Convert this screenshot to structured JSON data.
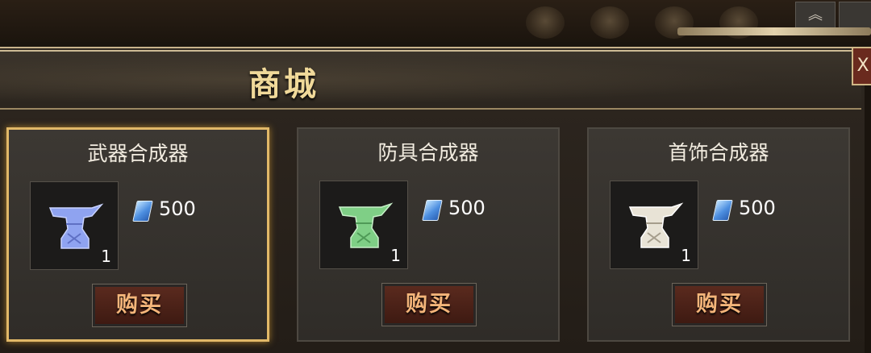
{
  "shop": {
    "title": "商城",
    "close_glyph": "X"
  },
  "items": [
    {
      "name": "武器合成器",
      "icon": "anvil-blue-icon",
      "color": "#8fa3f0",
      "quantity": "1",
      "price": "500",
      "currency_icon": "blue-gem-icon",
      "buy_label": "购买",
      "selected": true
    },
    {
      "name": "防具合成器",
      "icon": "anvil-green-icon",
      "color": "#7fcf86",
      "quantity": "1",
      "price": "500",
      "currency_icon": "blue-gem-icon",
      "buy_label": "购买",
      "selected": false
    },
    {
      "name": "首饰合成器",
      "icon": "anvil-white-icon",
      "color": "#e8e3d6",
      "quantity": "1",
      "price": "500",
      "currency_icon": "blue-gem-icon",
      "buy_label": "购买",
      "selected": false
    }
  ],
  "hud": {
    "collapse_glyph": "︽"
  }
}
